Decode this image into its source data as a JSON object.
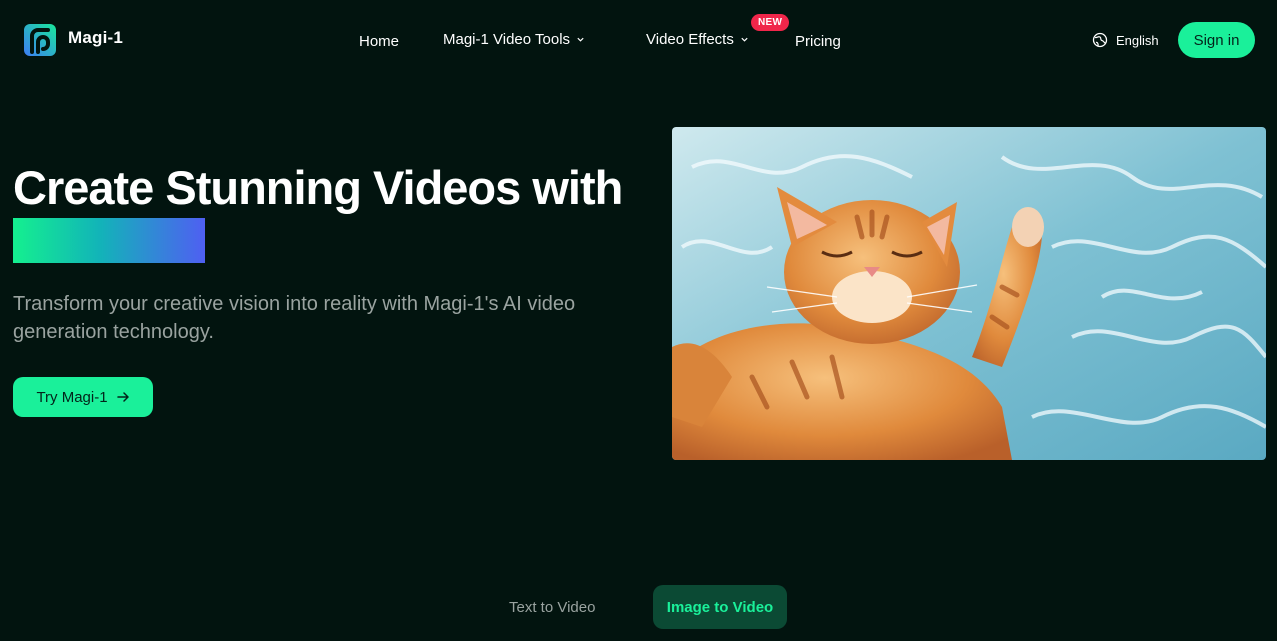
{
  "header": {
    "logo_text": "Magi-1",
    "nav": {
      "home": "Home",
      "tools": "Magi-1 Video Tools",
      "effects": "Video Effects",
      "effects_badge": "NEW",
      "pricing": "Pricing"
    },
    "language": "English",
    "signin_label": "Sign in"
  },
  "hero": {
    "title": "Create Stunning Videos with",
    "subtitle": "Transform your creative vision into reality with Magi-1's AI video generation technology.",
    "cta_label": "Try Magi-1"
  },
  "tabs": {
    "text_to_video": "Text to Video",
    "image_to_video": "Image to Video",
    "active": "image_to_video"
  },
  "colors": {
    "background": "#02140f",
    "accent": "#1af09a",
    "badge": "#f0264a",
    "gradient": [
      "#14f08f",
      "#12b4b8",
      "#4f5ff2"
    ]
  },
  "icons": {
    "logo": "magi-logo-icon",
    "chevron": "chevron-down-icon",
    "globe": "globe-icon",
    "arrow": "arrow-right-icon"
  }
}
